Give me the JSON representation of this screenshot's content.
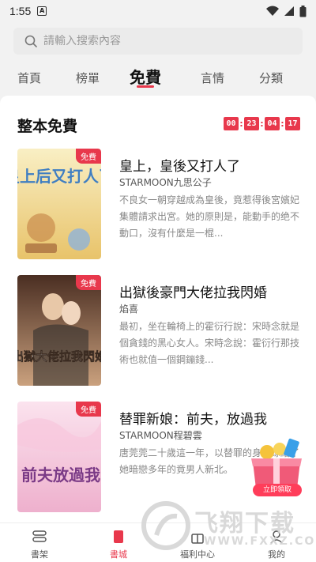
{
  "status_bar": {
    "time": "1:55",
    "badge": "A"
  },
  "search": {
    "placeholder": "請輸入搜索內容"
  },
  "tabs": [
    {
      "label": "首頁"
    },
    {
      "label": "榜單"
    },
    {
      "label": "免費",
      "active": true
    },
    {
      "label": "言情"
    },
    {
      "label": "分類"
    }
  ],
  "section": {
    "title": "整本免費",
    "countdown": [
      "00",
      "23",
      "04",
      "17"
    ]
  },
  "free_tag": "免費",
  "books": [
    {
      "title": "皇上，皇後又打人了",
      "author": "STARMOON九思公子",
      "desc": "不良女一朝穿越成為皇後，竟惹得後宮嬪妃集體請求出宮。她的原則是，能動手的绝不動口，沒有什麼是一棍..."
    },
    {
      "title": "出獄後豪門大佬拉我閃婚",
      "author": "焰喜",
      "desc": "最初，坐在輪椅上的霍衍行說：宋時念就是個貪錢的黑心女人。宋時念說：霍衍行那技術也就值一個鋼鏰錢..."
    },
    {
      "title": "替罪新娘：前夫，放過我",
      "author": "STARMOON程碧雲",
      "desc": "唐莞莞二十歲這一年，以替罪的身份嫁給了她暗戀多年的竟男人新北。"
    }
  ],
  "covers": [
    {
      "text": "皇上后又打人了",
      "colors": [
        "#f6e7a8",
        "#d9a94a"
      ]
    },
    {
      "text": "出獄大佬拉我閃婚",
      "colors": [
        "#5b3a2a",
        "#c9a58a"
      ]
    },
    {
      "text": "前夫放過我",
      "colors": [
        "#f6d5e4",
        "#e9a7c6"
      ]
    }
  ],
  "gift": {
    "label": "立即領取"
  },
  "bottom_nav": [
    {
      "label": "書架",
      "icon": "bookshelf-icon"
    },
    {
      "label": "書城",
      "icon": "bookstore-icon",
      "active": true
    },
    {
      "label": "福利中心",
      "icon": "welfare-icon"
    },
    {
      "label": "我的",
      "icon": "profile-icon"
    }
  ],
  "watermark": {
    "text": "飞翔下载",
    "url": "WWW.FXXZ.COM"
  },
  "colors": {
    "accent": "#e8384c",
    "background": "#f2f2f2"
  }
}
